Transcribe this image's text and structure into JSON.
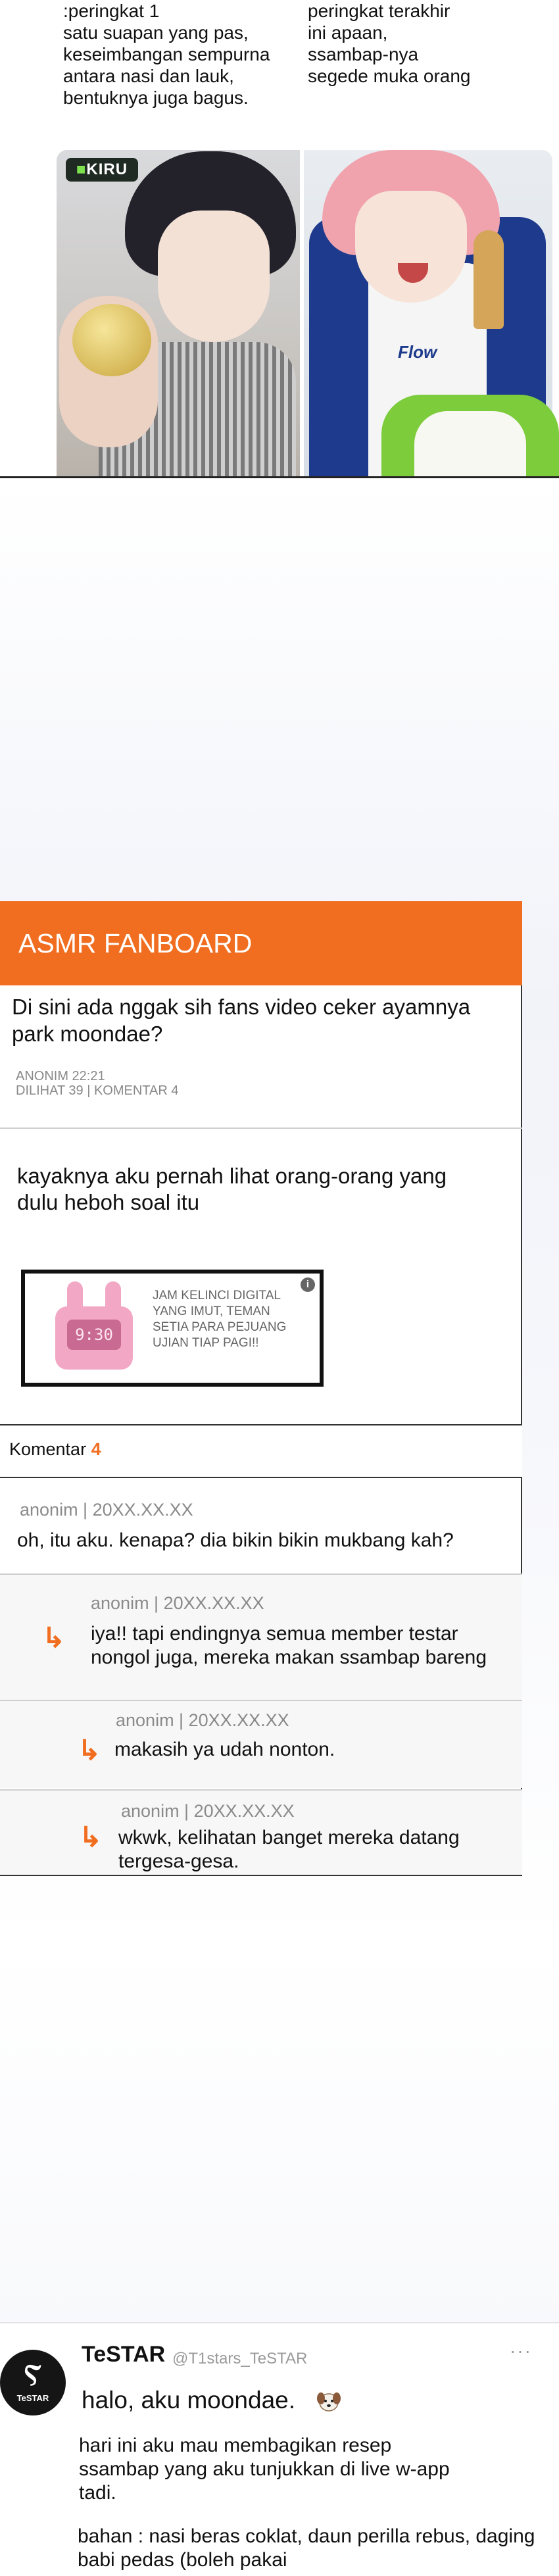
{
  "comic": {
    "left_caption": ":peringkat 1\nsatu suapan yang pas,\nkeseimbangan sempurna\nantara nasi dan lauk,\nbentuknya juga bagus.",
    "right_caption": "peringkat terakhir\nini apaan,\nssambap-nya\nsegede muka orang",
    "logo_text": "KIRU",
    "shirt_text": "Flow"
  },
  "forum": {
    "board_title": "ASMR FANBOARD",
    "post_title": "Di sini ada nggak sih fans video ceker ayamnya park moondae?",
    "post_meta_line1": "ANONIM 22:21",
    "post_meta_line2": "DILIHAT 39 | KOMENTAR 4",
    "post_body": "kayaknya aku pernah lihat orang-orang yang dulu heboh soal itu",
    "ad": {
      "text": "JAM KELINCI DIGITAL YANG IMUT, TEMAN SETIA PARA PEJUANG UJIAN TIAP PAGI!!",
      "clock_display": "9:30",
      "info_symbol": "i"
    },
    "comments_label": "Komentar",
    "comments_count": "4",
    "comments": [
      {
        "meta": "anonim | 20XX.XX.XX",
        "text": "oh, itu aku. kenapa? dia bikin bikin mukbang kah?"
      },
      {
        "meta": "anonim | 20XX.XX.XX",
        "text": "iya!! tapi endingnya  semua member testar nongol juga, mereka makan ssambap bareng"
      },
      {
        "meta": "anonim | 20XX.XX.XX",
        "text": "makasih ya udah nonton."
      },
      {
        "meta": "anonim | 20XX.XX.XX",
        "text": "wkwk, kelihatan banget mereka datang tergesa-gesa."
      }
    ],
    "reply_arrow": "↳"
  },
  "tweet": {
    "avatar_mark": "Ⲋ",
    "avatar_sub": "TeSTAR",
    "name": "TeSTAR",
    "handle": "@T1stars_TeSTAR",
    "more": "···",
    "line1": "halo, aku moondae.",
    "para1": "hari ini aku mau membagikan resep ssambap yang aku tunjukkan di live w-app tadi.",
    "para2": "bahan : nasi beras coklat, daun perilla rebus, daging babi pedas (boleh pakai"
  },
  "colors": {
    "accent": "#f16d1f",
    "card_border": "#333333",
    "meta_gray": "#8a8a8a"
  }
}
